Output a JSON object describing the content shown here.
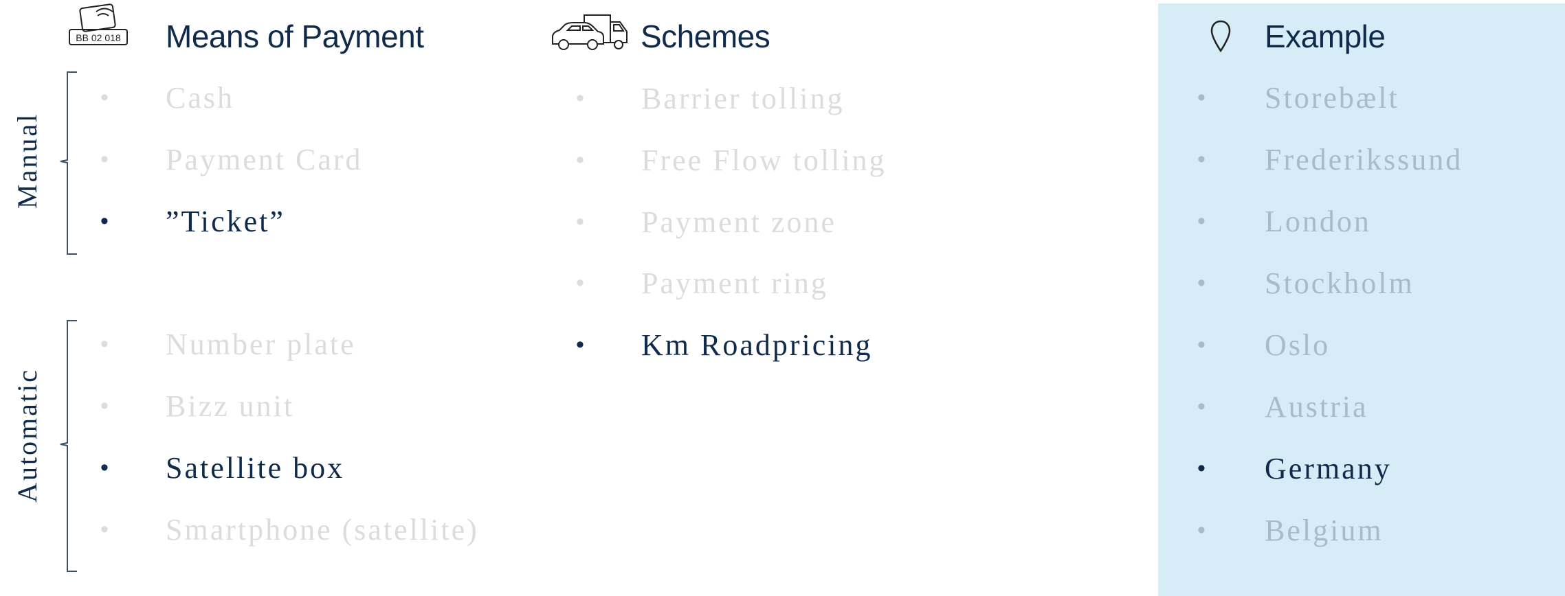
{
  "columns": {
    "payment": {
      "title": "Means of Payment",
      "icon": "number-plate-tag-icon",
      "icon_text": "BB 02 018",
      "groups": [
        {
          "label": "Manual",
          "items": [
            {
              "label": "Cash",
              "active": false
            },
            {
              "label": "Payment Card",
              "active": false
            },
            {
              "label": "”Ticket”",
              "active": true
            }
          ]
        },
        {
          "label": "Automatic",
          "items": [
            {
              "label": "Number plate",
              "active": false
            },
            {
              "label": "Bizz unit",
              "active": false
            },
            {
              "label": "Satellite box",
              "active": true
            },
            {
              "label": "Smartphone (satellite)",
              "active": false
            }
          ]
        }
      ]
    },
    "schemes": {
      "title": "Schemes",
      "icon": "car-and-truck-icon",
      "items": [
        {
          "label": "Barrier tolling",
          "active": false
        },
        {
          "label": "Free Flow tolling",
          "active": false
        },
        {
          "label": "Payment zone",
          "active": false
        },
        {
          "label": "Payment ring",
          "active": false
        },
        {
          "label": "Km Roadpricing",
          "active": true
        }
      ]
    },
    "example": {
      "title": "Example",
      "icon": "location-pin-icon",
      "items": [
        {
          "label": "Storebælt",
          "active": false
        },
        {
          "label": "Frederikssund",
          "active": false
        },
        {
          "label": "London",
          "active": false
        },
        {
          "label": "Stockholm",
          "active": false
        },
        {
          "label": "Oslo",
          "active": false
        },
        {
          "label": "Austria",
          "active": false
        },
        {
          "label": "Germany",
          "active": true
        },
        {
          "label": "Belgium",
          "active": false
        }
      ]
    }
  },
  "colors": {
    "active_text": "#0f2a4a",
    "inactive_text": "#dcdcdc",
    "inactive_text_on_panel": "#a7bccb",
    "example_panel_bg": "#d6ecf7"
  }
}
